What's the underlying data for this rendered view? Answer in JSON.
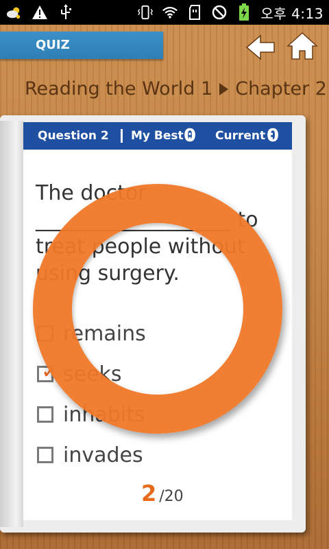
{
  "statusbar": {
    "icons": [
      "weather-icon",
      "warning-icon",
      "usb-icon",
      "vibrate-icon",
      "wifi-icon",
      "sd-card-icon",
      "no-signal-icon",
      "battery-charging-icon"
    ],
    "time": "오후 4:13"
  },
  "header": {
    "quiz_label": "QUIZ",
    "back_icon": "back-arrow-icon",
    "home_icon": "home-icon"
  },
  "breadcrumb": {
    "book": "Reading the World 1",
    "chapter": "Chapter 2"
  },
  "question_bar": {
    "question_label": "Question 2",
    "best_label": "My Best :",
    "best_value": "0",
    "current_label": "Current :",
    "current_value": "0"
  },
  "question": {
    "line1": "The doctor",
    "line2_blank": "___________________",
    "line2_after": " to",
    "line3": "treat people without",
    "line4": "using surgery."
  },
  "options": [
    {
      "label": "remains",
      "checked": false
    },
    {
      "label": "seeks",
      "checked": true
    },
    {
      "label": "inhabits",
      "checked": false
    },
    {
      "label": "invades",
      "checked": false
    }
  ],
  "feedback": {
    "result": "correct",
    "mark": "O",
    "color": "#ef7828"
  },
  "pager": {
    "current": "2",
    "total": "/20"
  }
}
